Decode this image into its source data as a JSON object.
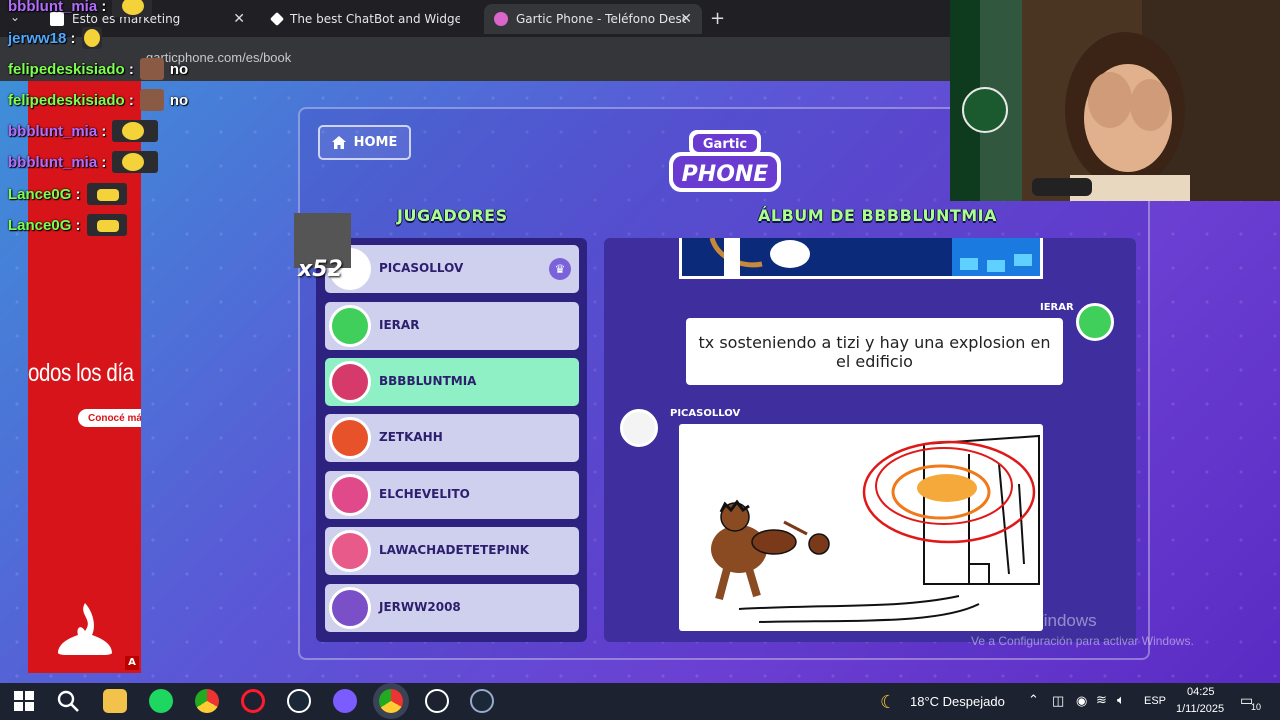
{
  "browser": {
    "tabs": [
      {
        "title": "Esto es marketing"
      },
      {
        "title": "The best ChatBot and Widgets"
      },
      {
        "title": "Gartic Phone - Teléfono Descon"
      }
    ],
    "url": "garticphone.com/es/book"
  },
  "chat": [
    {
      "user": "bbblunt_mia",
      "color": "#b46cff",
      "msg": ""
    },
    {
      "user": "jerww18",
      "color": "#4fa8ff",
      "msg": ""
    },
    {
      "user": "felipedeskisiado",
      "color": "#7cff4f",
      "msg": "no"
    },
    {
      "user": "felipedeskisiado",
      "color": "#7cff4f",
      "msg": "no"
    },
    {
      "user": "bbblunt_mia",
      "color": "#b46cff",
      "msg": ""
    },
    {
      "user": "bbblunt_mia",
      "color": "#b46cff",
      "msg": ""
    },
    {
      "user": "Lance0G",
      "color": "#7cff4f",
      "msg": ""
    },
    {
      "user": "Lance0G",
      "color": "#7cff4f",
      "msg": ""
    }
  ],
  "ad": {
    "text": "odos los día",
    "button": "Conocé más",
    "badge": "A"
  },
  "game": {
    "home": "HOME",
    "logo_top": "Gartic",
    "logo_bottom": "PHONE",
    "players_heading": "JUGADORES",
    "album_heading": "ÁLBUM DE BBBBLUNTMIA",
    "badge_count": "x52",
    "players": [
      {
        "name": "PICASOLLOV",
        "color": "#ffffff",
        "host": true
      },
      {
        "name": "IERAR",
        "color": "#3fcf5a"
      },
      {
        "name": "BBBBLUNTMIA",
        "color": "#d63a6a",
        "selected": true
      },
      {
        "name": "ZETKAHH",
        "color": "#e8522a"
      },
      {
        "name": "ELCHEVELITO",
        "color": "#e04a8a"
      },
      {
        "name": "LAWACHADETETEPINK",
        "color": "#e85a8a"
      },
      {
        "name": "JERWW2008",
        "color": "#7a4fc8"
      }
    ],
    "album": {
      "entry1_author": "IERAR",
      "entry1_text": "tx sosteniendo a tizi y hay una explosion en el edificio",
      "entry2_author": "PICASOLLOV"
    }
  },
  "windows": {
    "watermark_title": "Activar Windows",
    "watermark_sub": "Ve a Configuración para activar Windows."
  },
  "taskbar": {
    "weather": "18°C  Despejado",
    "lang": "ESP",
    "time": "04:25",
    "date": "1/11/2025",
    "notifications": "10"
  }
}
